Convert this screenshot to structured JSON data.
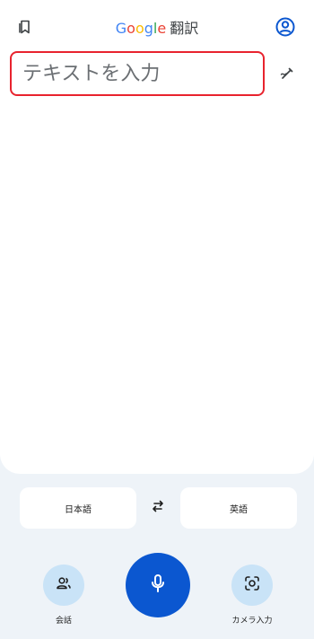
{
  "header": {
    "title_g1": "G",
    "title_o1": "o",
    "title_o2": "o",
    "title_g2": "g",
    "title_l": "l",
    "title_e": "e",
    "title_product": "翻訳"
  },
  "input": {
    "placeholder": "テキストを入力",
    "value": ""
  },
  "languages": {
    "source": "日本語",
    "target": "英語"
  },
  "actions": {
    "conversation_label": "会話",
    "camera_label": "カメラ入力"
  },
  "colors": {
    "accent": "#0b57d0",
    "input_border": "#e8232e",
    "chip_bg": "#c9e3f7"
  },
  "icons": {
    "saved": "bookmark-icon",
    "account": "account-icon",
    "handwrite": "pen-icon",
    "swap": "swap-icon",
    "conversation": "people-icon",
    "mic": "mic-icon",
    "camera": "camera-icon"
  }
}
